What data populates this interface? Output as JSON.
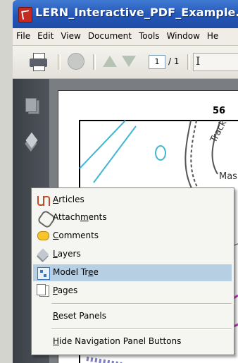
{
  "window": {
    "title": "LERN_Interactive_PDF_Example.pdf -"
  },
  "menubar": {
    "items": [
      "File",
      "Edit",
      "View",
      "Document",
      "Tools",
      "Window",
      "He"
    ]
  },
  "toolbar": {
    "page_current": "1",
    "page_total": "/ 1",
    "cursor_tool_label": "I"
  },
  "document": {
    "page_number_label": "56",
    "map_label_track": "Track",
    "map_label_mas": "Mas"
  },
  "context_menu": {
    "items": [
      {
        "label": "Articles",
        "mnemonic_index": 0,
        "icon": "articles-icon"
      },
      {
        "label": "Attachments",
        "mnemonic_index": 6,
        "icon": "paperclip-icon"
      },
      {
        "label": "Comments",
        "mnemonic_index": 0,
        "icon": "comment-icon"
      },
      {
        "label": "Layers",
        "mnemonic_index": 0,
        "icon": "layers-icon"
      },
      {
        "label": "Model Tree",
        "mnemonic_index": 8,
        "icon": "model-tree-icon",
        "selected": true
      },
      {
        "label": "Pages",
        "mnemonic_index": 0,
        "icon": "pages-icon"
      }
    ],
    "actions": [
      {
        "label": "Reset Panels",
        "mnemonic_index": 0
      },
      {
        "label": "Hide Navigation Panel Buttons",
        "mnemonic_index": 0
      }
    ]
  },
  "colors": {
    "titlebar": "#2456b8",
    "menu_highlight": "#b6cfe2",
    "nav_panel": "#454a51"
  }
}
